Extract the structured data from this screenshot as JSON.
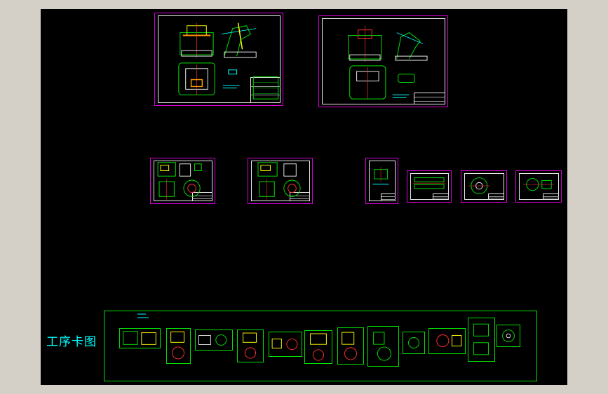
{
  "viewport": {
    "background": "#000000",
    "window_bg": "#d4d0c8"
  },
  "colors": {
    "sheet_border": "#d400d4",
    "sheet_inner": "#e8e8e8",
    "geometry_green": "#00e000",
    "geometry_cyan": "#00ffff",
    "geometry_yellow": "#ffff00",
    "geometry_red": "#ff3030",
    "geometry_orange": "#ff9900"
  },
  "process_cards": {
    "title": "工序卡图"
  },
  "sheets": [
    {
      "name": "assembly-drawing-1"
    },
    {
      "name": "assembly-drawing-2"
    },
    {
      "name": "part-drawing-a"
    },
    {
      "name": "part-drawing-b"
    },
    {
      "name": "detail-drawing-1"
    },
    {
      "name": "detail-drawing-2"
    },
    {
      "name": "detail-drawing-3"
    },
    {
      "name": "detail-drawing-4"
    }
  ]
}
